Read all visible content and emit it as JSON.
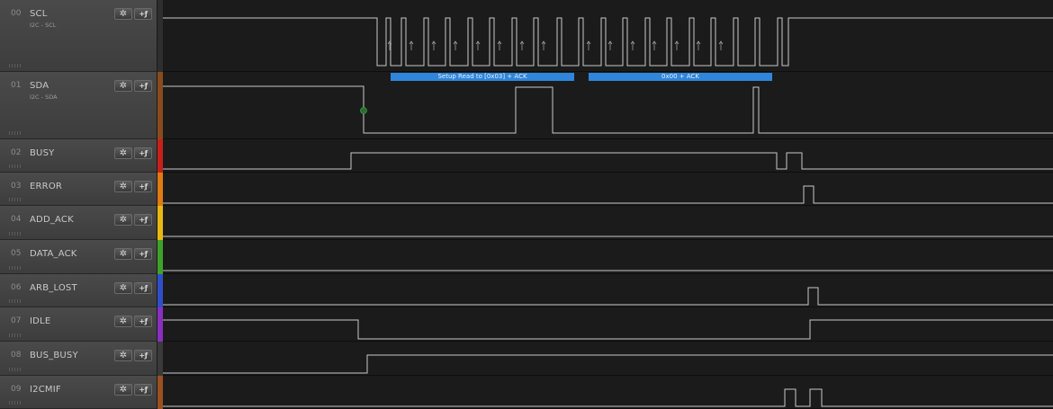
{
  "channels": [
    {
      "num": "00",
      "name": "SCL",
      "sub": "I2C - SCL",
      "color": "#2e2e2e"
    },
    {
      "num": "01",
      "name": "SDA",
      "sub": "I2C - SDA",
      "color": "#8a4b1c"
    },
    {
      "num": "02",
      "name": "BUSY",
      "sub": "",
      "color": "#c8201a"
    },
    {
      "num": "03",
      "name": "ERROR",
      "sub": "",
      "color": "#e07b12"
    },
    {
      "num": "04",
      "name": "ADD_ACK",
      "sub": "",
      "color": "#e8b812"
    },
    {
      "num": "05",
      "name": "DATA_ACK",
      "sub": "",
      "color": "#3fa12a"
    },
    {
      "num": "06",
      "name": "ARB_LOST",
      "sub": "",
      "color": "#2f4fc8"
    },
    {
      "num": "07",
      "name": "IDLE",
      "sub": "",
      "color": "#8a2fc0"
    },
    {
      "num": "08",
      "name": "BUS_BUSY",
      "sub": "",
      "color": "#3a3a3a"
    },
    {
      "num": "09",
      "name": "I2CMIF",
      "sub": "",
      "color": "#9a5020"
    }
  ],
  "buttons": {
    "gear_icon": "gear-icon",
    "trigger_icon": "trigger-icon",
    "trigger_label": "+ƒ"
  },
  "decoder": {
    "frames": [
      {
        "label": "Setup Read to [0x03] + ACK"
      },
      {
        "label": "0x00 + ACK"
      }
    ]
  },
  "colors": {
    "trace": "#c8c8c8",
    "sda_marker": "#2a6e33",
    "decoder": "#2f86da"
  }
}
